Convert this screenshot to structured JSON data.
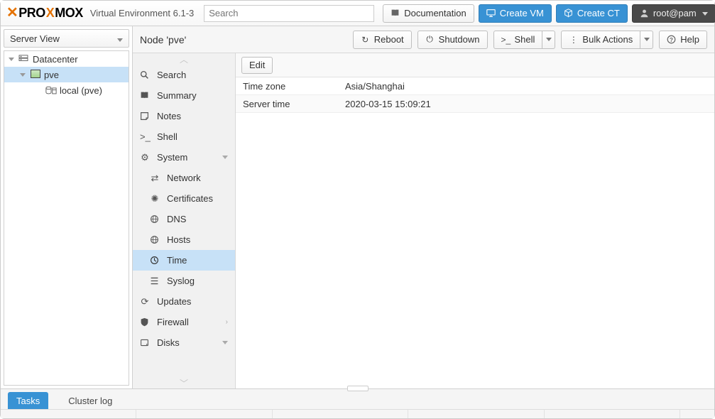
{
  "header": {
    "product": {
      "pre": "PRO",
      "x": "X",
      "post": "MOX"
    },
    "subtitle": "Virtual Environment 6.1-3",
    "search_placeholder": "Search",
    "documentation_label": "Documentation",
    "create_vm_label": "Create VM",
    "create_ct_label": "Create CT",
    "user_label": "root@pam"
  },
  "serverview": {
    "combo_label": "Server View",
    "tree": {
      "root": "Datacenter",
      "node": "pve",
      "storage": "local (pve)"
    }
  },
  "node": {
    "title": "Node 'pve'",
    "reboot_label": "Reboot",
    "shutdown_label": "Shutdown",
    "shell_label": "Shell",
    "bulk_label": "Bulk Actions",
    "help_label": "Help"
  },
  "sidenav": {
    "search": "Search",
    "summary": "Summary",
    "notes": "Notes",
    "shell": "Shell",
    "system": "System",
    "network": "Network",
    "certificates": "Certificates",
    "dns": "DNS",
    "hosts": "Hosts",
    "time": "Time",
    "syslog": "Syslog",
    "updates": "Updates",
    "firewall": "Firewall",
    "disks": "Disks"
  },
  "content": {
    "edit_label": "Edit",
    "rows": {
      "tz_key": "Time zone",
      "tz_val": "Asia/Shanghai",
      "st_key": "Server time",
      "st_val": "2020-03-15 15:09:21"
    }
  },
  "bottom": {
    "tasks": "Tasks",
    "clusterlog": "Cluster log"
  }
}
